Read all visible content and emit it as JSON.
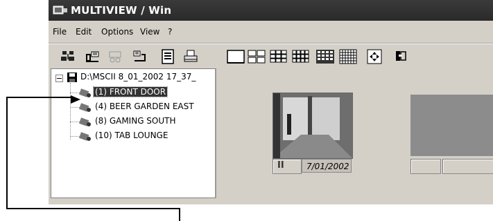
{
  "window": {
    "title": "MULTIVIEW / Win"
  },
  "menu": {
    "items": [
      "File",
      "Edit",
      "Options",
      "View",
      "?"
    ]
  },
  "toolbar": {
    "icons": [
      "camera-group-icon",
      "open-icon",
      "disabled-icon",
      "export-icon",
      "list-icon",
      "print-icon",
      "layout-1-icon",
      "layout-4-icon",
      "layout-9-icon",
      "layout-12-icon",
      "layout-16-icon",
      "layout-25-icon",
      "move-icon",
      "exit-icon"
    ]
  },
  "tree": {
    "root_label": "D:\\MSCII 8_01_2002 17_37_",
    "cameras": [
      "(1) FRONT DOOR",
      "(4) BEER GARDEN EAST",
      "(8) GAMING SOUTH",
      "(10) TAB LOUNGE"
    ],
    "selected_index": 0
  },
  "viewer": {
    "date": "7/01/2002",
    "pause_symbol": "II"
  }
}
